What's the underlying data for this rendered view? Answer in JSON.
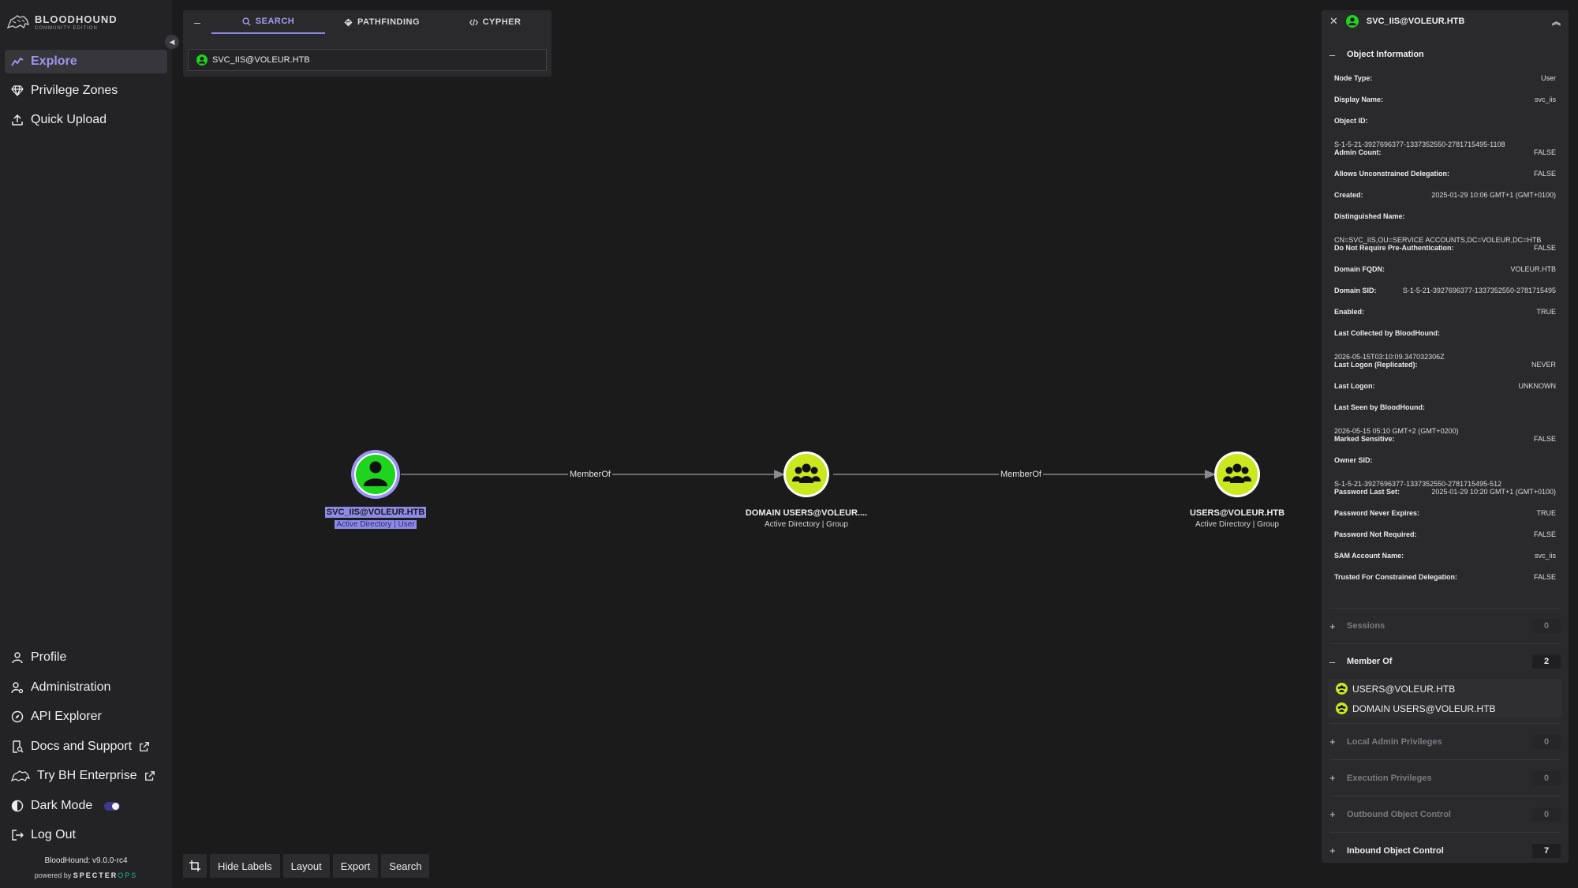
{
  "sidebar": {
    "logo_title": "BLOODHOUND",
    "logo_subtitle": "COMMUNITY EDITION",
    "nav_top": [
      {
        "label": "Explore",
        "icon": "chart-line-icon",
        "active": true
      },
      {
        "label": "Privilege Zones",
        "icon": "gem-icon"
      },
      {
        "label": "Quick Upload",
        "icon": "upload-icon"
      }
    ],
    "nav_bottom": [
      {
        "label": "Profile",
        "icon": "user-icon"
      },
      {
        "label": "Administration",
        "icon": "user-gear-icon"
      },
      {
        "label": "API Explorer",
        "icon": "compass-icon"
      },
      {
        "label": "Docs and Support",
        "icon": "book-search-icon"
      },
      {
        "label": "Try BH Enterprise",
        "icon": "hound-icon"
      },
      {
        "label": "Dark Mode",
        "icon": "contrast-icon"
      },
      {
        "label": "Log Out",
        "icon": "logout-icon"
      }
    ],
    "version": "BloodHound: v9.0.0-rc4",
    "powered_prefix": "powered by",
    "powered_brand_a": "SPECTER",
    "powered_brand_b": "OPS",
    "dark_mode_on": true
  },
  "search": {
    "tabs": [
      {
        "label": "SEARCH",
        "active": true
      },
      {
        "label": "PATHFINDING"
      },
      {
        "label": "CYPHER"
      }
    ],
    "value": "SVC_IIS@VOLEUR.HTB"
  },
  "graph": {
    "nodes": [
      {
        "label": "SVC_IIS@VOLEUR.HTB",
        "sub": "Active Directory | User",
        "kind": "user",
        "selected": true
      },
      {
        "label": "DOMAIN USERS@VOLEUR....",
        "sub": "Active Directory | Group",
        "kind": "group"
      },
      {
        "label": "USERS@VOLEUR.HTB",
        "sub": "Active Directory | Group",
        "kind": "group"
      }
    ],
    "edges": [
      {
        "label": "MemberOf"
      },
      {
        "label": "MemberOf"
      }
    ],
    "colors": {
      "user": "#1ed41e",
      "group": "#cbe71f",
      "selected_ring": "#9b93f0"
    }
  },
  "toolbar": {
    "buttons": [
      "Hide Labels",
      "Layout",
      "Export",
      "Search"
    ]
  },
  "panel": {
    "title": "SVC_IIS@VOLEUR.HTB",
    "object_info_title": "Object Information",
    "props": {
      "node_type": {
        "k": "Node Type:",
        "v": "User"
      },
      "display_name": {
        "k": "Display Name:",
        "v": "svc_iis"
      },
      "object_id": {
        "k": "Object ID:",
        "v": "S-1-5-21-3927696377-1337352550-2781715495-1108"
      },
      "admin_count": {
        "k": "Admin Count:",
        "v": "FALSE"
      },
      "unconstrained": {
        "k": "Allows Unconstrained Delegation:",
        "v": "FALSE"
      },
      "created": {
        "k": "Created:",
        "v": "2025-01-29 10:06 GMT+1 (GMT+0100)"
      },
      "dn": {
        "k": "Distinguished Name:",
        "v": "CN=SVC_IIS,OU=SERVICE ACCOUNTS,DC=VOLEUR,DC=HTB"
      },
      "no_preauth": {
        "k": "Do Not Require Pre-Authentication:",
        "v": "FALSE"
      },
      "domain_fqdn": {
        "k": "Domain FQDN:",
        "v": "VOLEUR.HTB"
      },
      "domain_sid": {
        "k": "Domain SID:",
        "v": "S-1-5-21-3927696377-1337352550-2781715495"
      },
      "enabled": {
        "k": "Enabled:",
        "v": "TRUE"
      },
      "last_collected": {
        "k": "Last Collected by BloodHound:",
        "v": "2026-05-15T03:10:09.347032306Z"
      },
      "last_logon_repl": {
        "k": "Last Logon (Replicated):",
        "v": "NEVER"
      },
      "last_logon": {
        "k": "Last Logon:",
        "v": "UNKNOWN"
      },
      "last_seen": {
        "k": "Last Seen by BloodHound:",
        "v": "2026-05-15 05:10 GMT+2 (GMT+0200)"
      },
      "marked_sensitive": {
        "k": "Marked Sensitive:",
        "v": "FALSE"
      },
      "owner_sid": {
        "k": "Owner SID:",
        "v": "S-1-5-21-3927696377-1337352550-2781715495-512"
      },
      "pwd_last_set": {
        "k": "Password Last Set:",
        "v": "2025-01-29 10:20 GMT+1 (GMT+0100)"
      },
      "pwd_never_expires": {
        "k": "Password Never Expires:",
        "v": "TRUE"
      },
      "pwd_not_required": {
        "k": "Password Not Required:",
        "v": "FALSE"
      },
      "sam_account": {
        "k": "SAM Account Name:",
        "v": "svc_iis"
      },
      "trusted_constrained": {
        "k": "Trusted For Constrained Delegation:",
        "v": "FALSE"
      }
    },
    "sessions": {
      "label": "Sessions",
      "count": "0"
    },
    "member_of": {
      "label": "Member Of",
      "count": "2",
      "items": [
        "USERS@VOLEUR.HTB",
        "DOMAIN USERS@VOLEUR.HTB"
      ]
    },
    "local_admin": {
      "label": "Local Admin Privileges",
      "count": "0"
    },
    "execution": {
      "label": "Execution Privileges",
      "count": "0"
    },
    "outbound": {
      "label": "Outbound Object Control",
      "count": "0"
    },
    "inbound": {
      "label": "Inbound Object Control",
      "count": "7"
    }
  }
}
